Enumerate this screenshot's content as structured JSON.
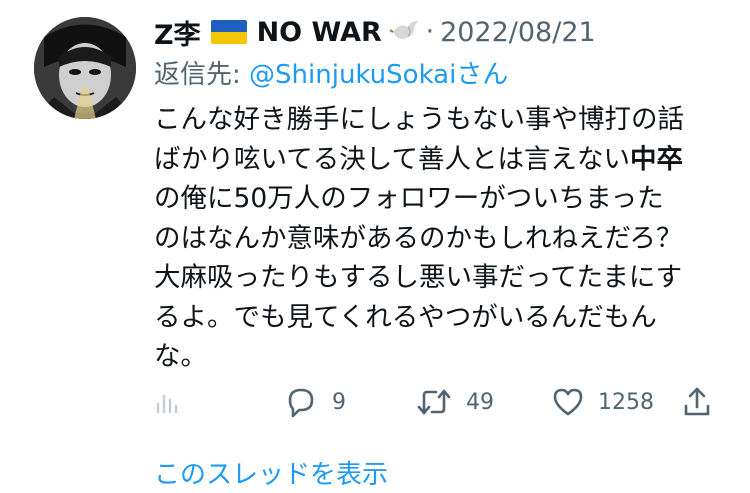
{
  "tweet": {
    "author_name": "Z李",
    "author_suffix": "NO WAR",
    "separator": "·",
    "date": "2022/08/21",
    "reply_prefix": "返信先: ",
    "reply_handle": "@ShinjukuSokai",
    "reply_suffix": "さん",
    "text_lines": [
      [
        "こんな好き勝手にしょうもない事や博打の話"
      ],
      [
        "ばかり呟いてる決して善人とは言えない",
        "中卒"
      ],
      [
        "の俺に50万人のフォロワーがついちまった"
      ],
      [
        "のはなんか意味があるのかもしれねえだろ？"
      ],
      [
        "大麻吸ったりもするし悪い事だってたまにす"
      ],
      [
        "るよ。でも見てくれるやつがいるんだもん"
      ],
      [
        "な。"
      ]
    ]
  },
  "actions": {
    "reply_count": "9",
    "retweet_count": "49",
    "like_count": "1258"
  },
  "thread_link": "このスレッドを表示",
  "colors": {
    "accent": "#1d9bf0",
    "muted": "#536471",
    "text": "#0f1419",
    "flag_blue": "#1f5fbf",
    "flag_yellow": "#f3c600"
  },
  "icons": [
    "analytics-icon",
    "reply-icon",
    "retweet-icon",
    "like-icon",
    "share-icon",
    "dove-icon"
  ]
}
